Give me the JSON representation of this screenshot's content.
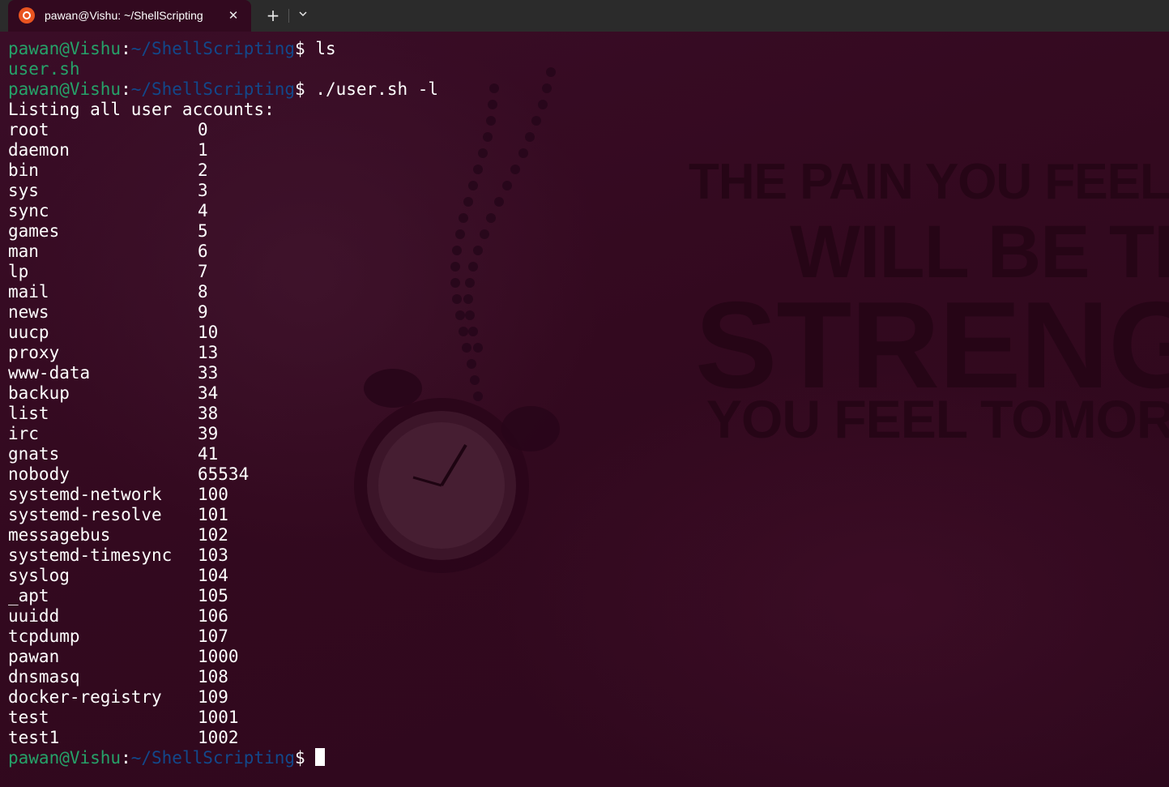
{
  "tabbar": {
    "tab_title": "pawan@Vishu: ~/ShellScripting",
    "close_glyph": "✕",
    "new_tab_glyph": "+",
    "dropdown_icon": "chevron-down-icon",
    "tab_icon": "ubuntu-logo-icon"
  },
  "colors": {
    "background": "#32091f",
    "prompt_user": "#26a269",
    "prompt_path": "#12488b",
    "text": "#ffffff"
  },
  "background_quote": {
    "line1": "THE PAIN YOU FEEL",
    "line2": "WILL BE TH",
    "line3": "STRENG",
    "line4": "YOU FEEL TOMOR"
  },
  "terminal": {
    "prompt_user": "pawan@Vishu",
    "prompt_colon": ":",
    "prompt_path": "~/ShellScripting",
    "prompt_dollar": "$ ",
    "cmd1": "ls",
    "ls_output": "user.sh",
    "cmd2": "./user.sh -l",
    "heading": "Listing all user accounts:",
    "users": [
      {
        "name": "root",
        "uid": "0"
      },
      {
        "name": "daemon",
        "uid": "1"
      },
      {
        "name": "bin",
        "uid": "2"
      },
      {
        "name": "sys",
        "uid": "3"
      },
      {
        "name": "sync",
        "uid": "4"
      },
      {
        "name": "games",
        "uid": "5"
      },
      {
        "name": "man",
        "uid": "6"
      },
      {
        "name": "lp",
        "uid": "7"
      },
      {
        "name": "mail",
        "uid": "8"
      },
      {
        "name": "news",
        "uid": "9"
      },
      {
        "name": "uucp",
        "uid": "10"
      },
      {
        "name": "proxy",
        "uid": "13"
      },
      {
        "name": "www-data",
        "uid": "33"
      },
      {
        "name": "backup",
        "uid": "34"
      },
      {
        "name": "list",
        "uid": "38"
      },
      {
        "name": "irc",
        "uid": "39"
      },
      {
        "name": "gnats",
        "uid": "41"
      },
      {
        "name": "nobody",
        "uid": "65534"
      },
      {
        "name": "systemd-network",
        "uid": "100"
      },
      {
        "name": "systemd-resolve",
        "uid": "101"
      },
      {
        "name": "messagebus",
        "uid": "102"
      },
      {
        "name": "systemd-timesync",
        "uid": "103"
      },
      {
        "name": "syslog",
        "uid": "104"
      },
      {
        "name": "_apt",
        "uid": "105"
      },
      {
        "name": "uuidd",
        "uid": "106"
      },
      {
        "name": "tcpdump",
        "uid": "107"
      },
      {
        "name": "pawan",
        "uid": "1000"
      },
      {
        "name": "dnsmasq",
        "uid": "108"
      },
      {
        "name": "docker-registry",
        "uid": "109"
      },
      {
        "name": "test",
        "uid": "1001"
      },
      {
        "name": "test1",
        "uid": "1002"
      }
    ]
  }
}
